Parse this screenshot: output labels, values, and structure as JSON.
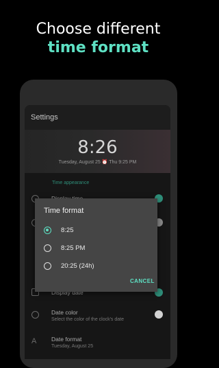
{
  "promo": {
    "line1": "Choose different",
    "line2": "time format"
  },
  "app": {
    "title": "Settings",
    "clock": "8:26",
    "date_line": "Tuesday, August 25  ⏰ Thu 9:25 PM",
    "section_label": "Time appearance",
    "rows": [
      {
        "title": "Display time",
        "subtitle": ""
      },
      {
        "title": "Display date",
        "subtitle": ""
      },
      {
        "title": "Date color",
        "subtitle": "Select the color of the clock's date"
      },
      {
        "title": "Date format",
        "subtitle": "Tuesday, August 25"
      }
    ]
  },
  "dialog": {
    "title": "Time format",
    "options": [
      {
        "label": "8:25",
        "selected": true
      },
      {
        "label": "8:25 PM",
        "selected": false
      },
      {
        "label": "20:25 (24h)",
        "selected": false
      }
    ],
    "cancel": "CANCEL"
  },
  "colors": {
    "accent": "#5ee0c3",
    "dialog_bg": "#454545"
  }
}
